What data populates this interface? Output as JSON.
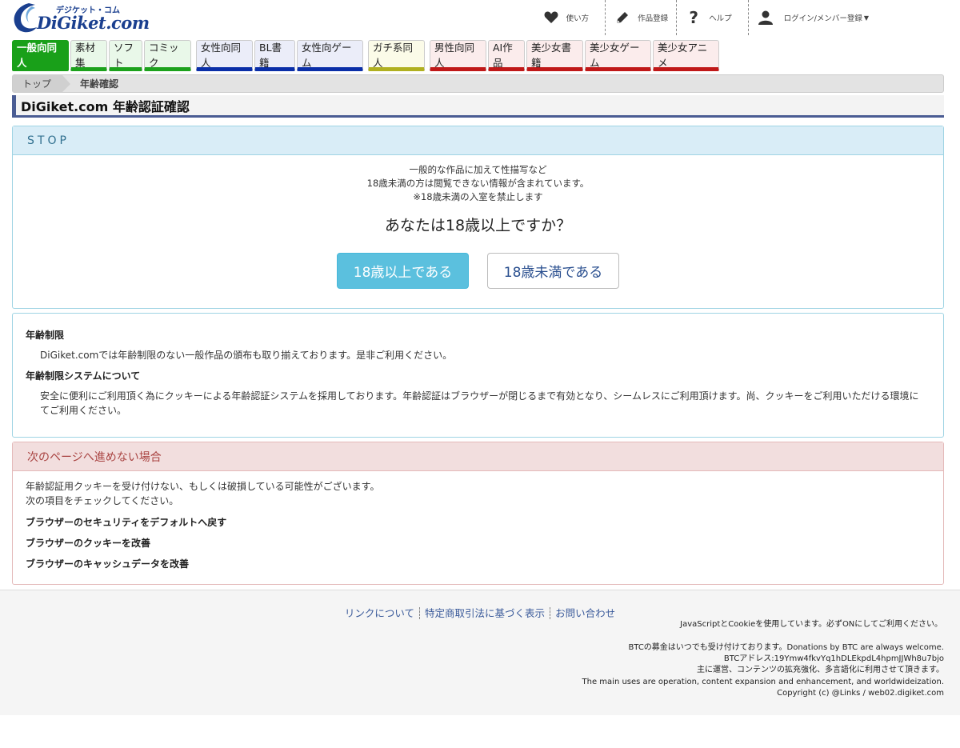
{
  "logo": {
    "kana": "デジケット・コム",
    "text": "DiGiket.com"
  },
  "topnav": [
    {
      "label": "使い方",
      "icon": "heart-icon"
    },
    {
      "label": "作品登録",
      "icon": "pencil-icon"
    },
    {
      "label": "ヘルプ",
      "icon": "question-icon"
    },
    {
      "label": "ログイン/メンバー登録",
      "icon": "user-icon"
    }
  ],
  "categories": [
    {
      "label": "一般向同人",
      "color": "green"
    },
    {
      "label": "素材集",
      "color": "green"
    },
    {
      "label": "ソフト",
      "color": "green"
    },
    {
      "label": "コミック",
      "color": "green"
    },
    {
      "label": "女性向同人",
      "color": "blue"
    },
    {
      "label": "BL書籍",
      "color": "blue"
    },
    {
      "label": "女性向ゲーム",
      "color": "blue"
    },
    {
      "label": "ガチ系同人",
      "color": "olive"
    },
    {
      "label": "男性向同人",
      "color": "red"
    },
    {
      "label": "AI作品",
      "color": "red"
    },
    {
      "label": "美少女書籍",
      "color": "red"
    },
    {
      "label": "美少女ゲーム",
      "color": "red"
    },
    {
      "label": "美少女アニメ",
      "color": "red"
    }
  ],
  "colors": {
    "green": "#1ca21c",
    "blue": "#0a2ea8",
    "olive": "#b0b020",
    "red": "#c01818",
    "info": "#5bc0de"
  },
  "breadcrumb": {
    "home": "トップ",
    "current": "年齢確認"
  },
  "page_title": "DiGiket.com 年齢認証確認",
  "stop": {
    "title": "STOP",
    "lines": [
      "一般的な作品に加えて性描写など",
      "18歳未満の方は閲覧できない情報が含まれています。",
      "※18歳未満の入室を禁止します"
    ],
    "question": "あなたは18歳以上ですか？",
    "yes": "18歳以上である",
    "no": "18歳未満である"
  },
  "info": {
    "h1": "年齢制限",
    "p1": "DiGiket.comでは年齢制限のない一般作品の頒布も取り揃えております。是非ご利用ください。",
    "h2": "年齢制限システムについて",
    "p2": "安全に便利にご利用頂く為にクッキーによる年齢認証システムを採用しております。年齢認証はブラウザーが閉じるまで有効となり、シームレスにご利用頂けます。尚、クッキーをご利用いただける環境にてご利用ください。"
  },
  "trouble": {
    "title": "次のページへ進めない場合",
    "p1": "年齢認証用クッキーを受け付けない、もしくは破損している可能性がございます。",
    "p2": "次の項目をチェックしてください。",
    "links": [
      "ブラウザーのセキュリティをデフォルトへ戻す",
      "ブラウザーのクッキーを改善",
      "ブラウザーのキャッシュデータを改善"
    ]
  },
  "footer": {
    "links": [
      "リンクについて",
      "特定商取引法に基づく表示",
      "お問い合わせ"
    ],
    "cookie_note": "JavaScriptとCookieを使用しています。必ずONにしてご利用ください。",
    "btc1": "BTCの募金はいつでも受け付けております。Donations by BTC are always welcome.",
    "btc2": "BTCアドレス:19Ymw4fkvYq1hDLEkpdL4hpmJJWh8u7bjo",
    "btc3": "主に運営、コンテンツの拡充強化、多言語化に利用させて頂きます。",
    "btc4": "The main uses are operation, content expansion and enhancement, and worldwideization.",
    "copyright": "Copyright (c) @Links / web02.digiket.com"
  }
}
